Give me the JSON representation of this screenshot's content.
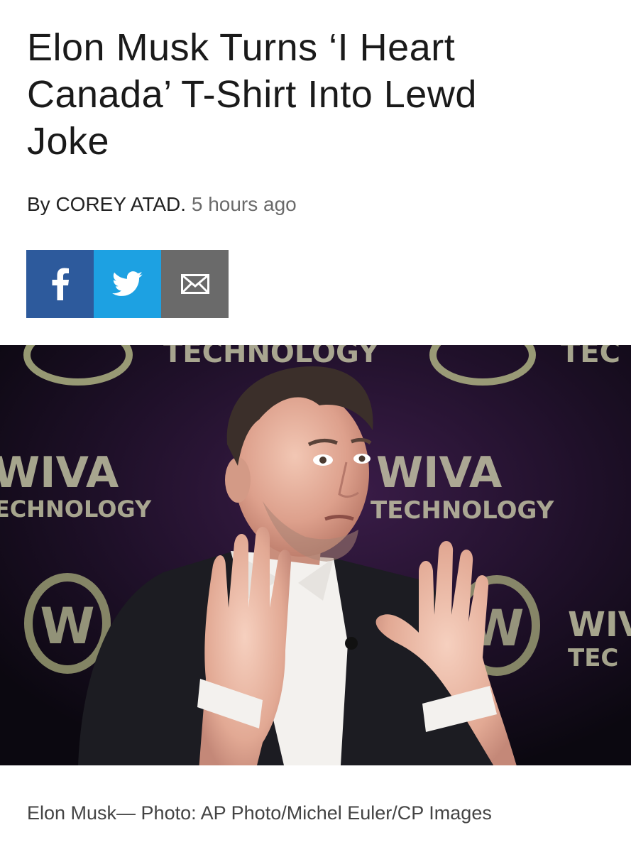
{
  "article": {
    "headline_lines": [
      "Elon Musk Turns ‘I Heart",
      "Canada’ T-Shirt Into Lewd",
      "Joke"
    ],
    "byline_prefix": "By COREY ATAD.",
    "byline_time": "5 hours ago"
  },
  "share": {
    "facebook_icon": "facebook-icon",
    "twitter_icon": "twitter-icon",
    "email_icon": "email-icon",
    "colors": {
      "facebook": "#2d5a9c",
      "twitter": "#1da1e2",
      "email": "#6a6a6a"
    }
  },
  "photo": {
    "backdrop_words": [
      "TECHNOLOGY",
      "WIVA",
      "TEC"
    ],
    "caption": "Elon Musk— Photo: AP Photo/Michel Euler/CP Images"
  }
}
